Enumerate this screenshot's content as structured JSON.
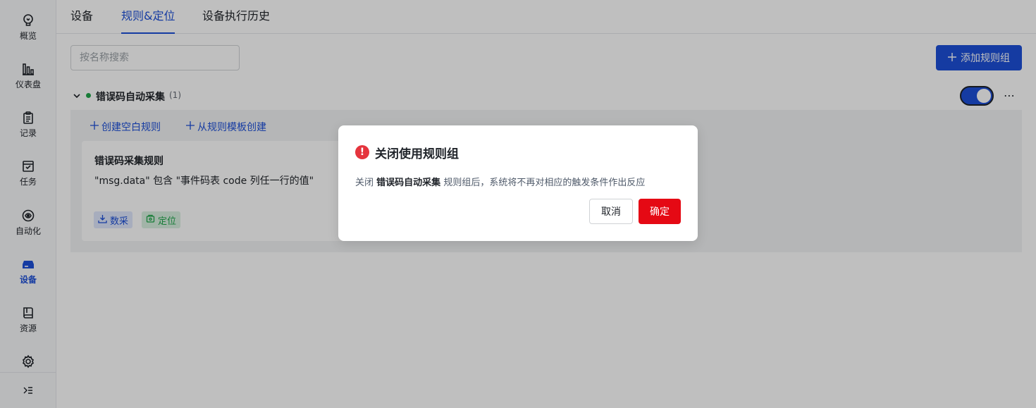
{
  "sidebar": {
    "items": [
      {
        "label": "概览",
        "icon": "lightbulb-icon"
      },
      {
        "label": "仪表盘",
        "icon": "bar-chart-icon"
      },
      {
        "label": "记录",
        "icon": "clipboard-icon"
      },
      {
        "label": "任务",
        "icon": "task-icon"
      },
      {
        "label": "自动化",
        "icon": "automation-icon"
      },
      {
        "label": "设备",
        "icon": "device-icon",
        "active": true
      },
      {
        "label": "资源",
        "icon": "book-icon"
      }
    ],
    "settings_icon": "gear-icon",
    "collapse_icon": "collapse-sidebar-icon"
  },
  "tabs": [
    {
      "label": "设备"
    },
    {
      "label": "规则&定位",
      "active": true
    },
    {
      "label": "设备执行历史"
    }
  ],
  "search": {
    "placeholder": "按名称搜索",
    "value": ""
  },
  "add_group_button": {
    "label": "添加规则组"
  },
  "rule_group": {
    "name": "错误码自动采集",
    "count": "(1)",
    "enabled": true,
    "status_color": "#1fa64a",
    "actions": {
      "create_blank": "创建空白规则",
      "create_from_template": "从规则模板创建"
    },
    "rules": [
      {
        "title": "错误码采集规则",
        "description": "\"msg.data\" 包含 \"事件码表 code 列任一行的值\"",
        "tags": [
          {
            "label": "数采",
            "icon": "download-icon"
          },
          {
            "label": "定位",
            "icon": "location-icon"
          }
        ]
      }
    ]
  },
  "dialog": {
    "title": "关闭使用规则组",
    "message_prefix": "关闭",
    "message_group": "错误码自动采集",
    "message_suffix": "规则组后，系统将不再对相应的触发条件作出反应",
    "cancel_label": "取消",
    "confirm_label": "确定"
  },
  "colors": {
    "accent": "#1d4fd8",
    "danger": "#e50914",
    "success": "#1fa64a"
  }
}
